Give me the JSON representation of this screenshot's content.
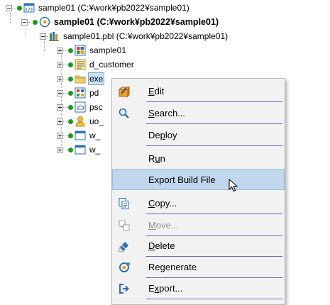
{
  "tree": {
    "workspace": "sample01 (C:¥work¥pb2022¥sample01)",
    "target": "sample01 (C:¥work¥pb2022¥sample01)",
    "library": "sample01.pbl (C:¥work¥pb2022¥sample01)",
    "objects": [
      {
        "label": "sample01",
        "icon": "application-icon"
      },
      {
        "label": "d_customer",
        "icon": "datawindow-icon"
      },
      {
        "label": "exe",
        "icon": "folder-icon"
      },
      {
        "label": "pd",
        "icon": "project-icon"
      },
      {
        "label": "psc",
        "icon": "cloud-project-icon"
      },
      {
        "label": "uo_",
        "icon": "user-object-icon"
      },
      {
        "label": "w_",
        "icon": "window-icon"
      },
      {
        "label": "w_",
        "icon": "window-icon"
      }
    ]
  },
  "menu": {
    "items": [
      {
        "label": "Edit",
        "accel": "E",
        "icon": "edit-icon"
      },
      {
        "label": "Search...",
        "accel": "S",
        "icon": "search-icon"
      },
      {
        "label": "Deploy",
        "accel": "p",
        "icon": ""
      },
      {
        "label": "Run",
        "accel": "u",
        "icon": ""
      },
      {
        "label": "Export Build File",
        "accel": "",
        "icon": ""
      },
      {
        "label": "Copy...",
        "accel": "C",
        "icon": "copy-icon"
      },
      {
        "label": "Move...",
        "accel": "M",
        "icon": "move-icon"
      },
      {
        "label": "Delete",
        "accel": "D",
        "icon": "delete-icon"
      },
      {
        "label": "Regenerate",
        "accel": "g",
        "icon": "regenerate-icon"
      },
      {
        "label": "Export...",
        "accel": "x",
        "icon": "export-icon"
      }
    ]
  }
}
